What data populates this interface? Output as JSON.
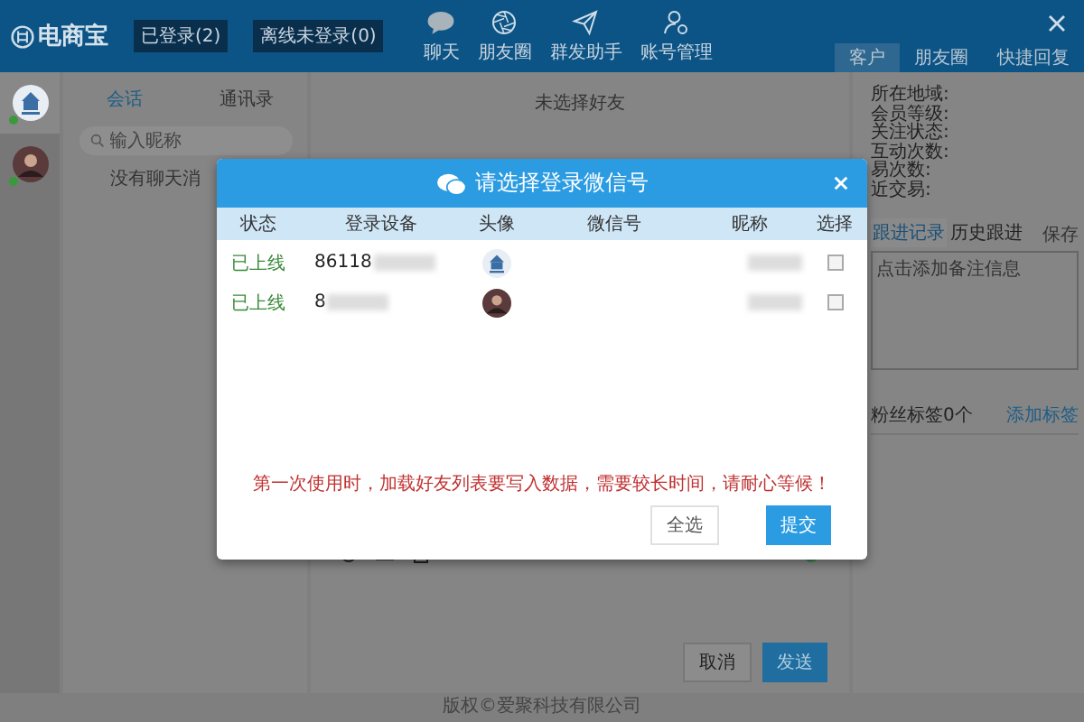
{
  "header": {
    "logo": "电商宝",
    "status_buttons": [
      "已登录(2)",
      "离线未登录(0)"
    ],
    "nav": [
      {
        "label": "聊天"
      },
      {
        "label": "朋友圈"
      },
      {
        "label": "群发助手"
      },
      {
        "label": "账号管理"
      }
    ],
    "tabs": [
      {
        "label": "客户",
        "selected": true
      },
      {
        "label": "朋友圈",
        "selected": false
      },
      {
        "label": "快捷回复",
        "selected": false
      }
    ]
  },
  "accounts": [
    {
      "kind": "logo",
      "online": true,
      "selected": true
    },
    {
      "kind": "photo",
      "online": true,
      "selected": false
    }
  ],
  "conversations": {
    "tabs": [
      {
        "label": "会话",
        "selected": true
      },
      {
        "label": "通讯录",
        "selected": false
      }
    ],
    "search": {
      "placeholder": "输入昵称"
    },
    "empty_text": "没有聊天消"
  },
  "chat": {
    "title": "未选择好友",
    "buttons": [
      {
        "label": "取消",
        "kind": "secondary"
      },
      {
        "label": "发送",
        "kind": "primary"
      }
    ]
  },
  "customer": {
    "fields": [
      "所在地域:",
      "会员等级:",
      "关注状态:",
      "互动次数:",
      "易次数:",
      "近交易:"
    ],
    "note_tabs": [
      {
        "label": "跟进记录",
        "selected": true
      },
      {
        "label": "历史跟进",
        "selected": false
      }
    ],
    "save": "保存",
    "note_placeholder": "点击添加备注信息",
    "tag_count": "粉丝标签0个",
    "add_tag": "添加标签"
  },
  "footer": "版权©爱聚科技有限公司",
  "dialog": {
    "title": "请选择登录微信号",
    "columns": [
      "状态",
      "登录设备",
      "头像",
      "微信号",
      "昵称",
      "选择"
    ],
    "rows": [
      {
        "status": "已上线",
        "device": "86118",
        "kind": "logo",
        "checked": false
      },
      {
        "status": "已上线",
        "device": "8",
        "kind": "photo",
        "checked": false
      }
    ],
    "notice": "第一次使用时，加载好友列表要写入数据，需要较长时间，请耐心等候！",
    "buttons": [
      {
        "label": "全选",
        "kind": "secondary"
      },
      {
        "label": "提交",
        "kind": "primary"
      }
    ]
  }
}
